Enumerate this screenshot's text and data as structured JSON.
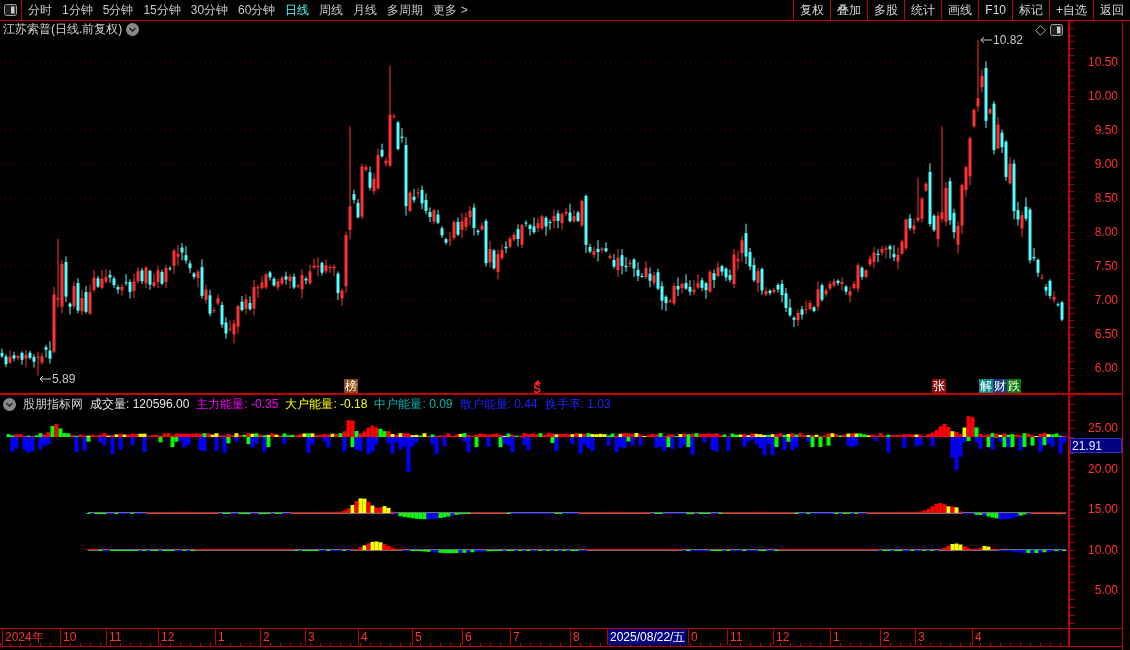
{
  "toolbar": {
    "periods": [
      {
        "label": "分时",
        "selected": false
      },
      {
        "label": "1分钟",
        "selected": false
      },
      {
        "label": "5分钟",
        "selected": false
      },
      {
        "label": "15分钟",
        "selected": false
      },
      {
        "label": "30分钟",
        "selected": false
      },
      {
        "label": "60分钟",
        "selected": false
      },
      {
        "label": "日线",
        "selected": true
      },
      {
        "label": "周线",
        "selected": false
      },
      {
        "label": "月线",
        "selected": false
      },
      {
        "label": "多周期",
        "selected": false
      },
      {
        "label": "更多 >",
        "selected": false
      }
    ],
    "actions": [
      "复权",
      "叠加",
      "多股",
      "统计",
      "画线",
      "F10",
      "标记",
      "+自选",
      "返回"
    ]
  },
  "price_chart": {
    "title": "江苏索普(日线.前复权)",
    "axis_labels": [
      "10.50",
      "10.00",
      "9.50",
      "9.00",
      "8.50",
      "8.00",
      "7.50",
      "7.00",
      "6.50",
      "6.00"
    ],
    "high_label": "10.82",
    "low_label": "5.89",
    "markers": [
      {
        "text": "榜",
        "kind": "tag",
        "color": "#8b4a1a"
      },
      {
        "text": "S",
        "kind": "glyph",
        "color": "#ff2020"
      },
      {
        "text": "张",
        "kind": "tag",
        "color": "#8c1010"
      },
      {
        "text": "解",
        "kind": "tag",
        "color": "#0a8a8a"
      },
      {
        "text": "财",
        "kind": "tag",
        "color": "#1a3a7a"
      },
      {
        "text": "跌",
        "kind": "tag",
        "color": "#0a7a0a"
      }
    ]
  },
  "indicator": {
    "name": "股朋指标网",
    "readings": [
      {
        "text": "成交量: 120596.00",
        "color": "#e6e6e6"
      },
      {
        "text": "主力能量: -0.35",
        "color": "#ff00ff"
      },
      {
        "text": "大户能量: -0.18",
        "color": "#ffff00"
      },
      {
        "text": "中户能量: 0.09",
        "color": "#00b4b4"
      },
      {
        "text": "散户能量: 0.44",
        "color": "#2020ff"
      },
      {
        "text": "换手率: 1.03",
        "color": "#2020ff"
      }
    ],
    "axis_labels": [
      "25.00",
      "20.00",
      "15.00",
      "10.00",
      "5.00"
    ],
    "cursor_value": "21.91"
  },
  "time_axis": [
    {
      "text": "2024年",
      "kind": "tick"
    },
    {
      "text": "10",
      "kind": "tick"
    },
    {
      "text": "11",
      "kind": "tick"
    },
    {
      "text": "12",
      "kind": "tick"
    },
    {
      "text": "1",
      "kind": "tick"
    },
    {
      "text": "2",
      "kind": "tick"
    },
    {
      "text": "3",
      "kind": "tick"
    },
    {
      "text": "4",
      "kind": "tick"
    },
    {
      "text": "5",
      "kind": "tick"
    },
    {
      "text": "6",
      "kind": "tick"
    },
    {
      "text": "7",
      "kind": "tick"
    },
    {
      "text": "8",
      "kind": "tick"
    },
    {
      "text": "2025/08/22/五",
      "kind": "cursor"
    },
    {
      "text": "0",
      "kind": "tick"
    },
    {
      "text": "11",
      "kind": "tick"
    },
    {
      "text": "12",
      "kind": "tick"
    },
    {
      "text": "1",
      "kind": "tick"
    },
    {
      "text": "2",
      "kind": "tick"
    },
    {
      "text": "3",
      "kind": "tick"
    },
    {
      "text": "4",
      "kind": "tick"
    }
  ]
}
